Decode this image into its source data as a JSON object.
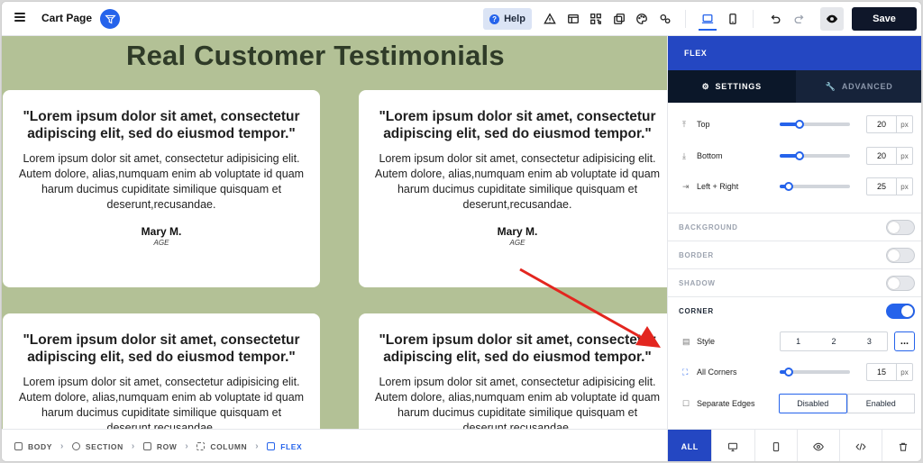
{
  "topbar": {
    "page_name": "Cart Page",
    "help_label": "Help",
    "save_label": "Save"
  },
  "canvas": {
    "title": "Real Customer Testimonials",
    "cards": [
      {
        "quote": "\"Lorem ipsum dolor sit amet, consectetur adipiscing elit, sed do eiusmod tempor.\"",
        "body": "Lorem ipsum dolor sit amet, consectetur adipisicing elit. Autem dolore, alias,numquam enim ab voluptate id quam harum ducimus cupiditate similique quisquam et deserunt,recusandae.",
        "name": "Mary M.",
        "age": "AGE"
      },
      {
        "quote": "\"Lorem ipsum dolor sit amet, consectetur adipiscing elit, sed do eiusmod tempor.\"",
        "body": "Lorem ipsum dolor sit amet, consectetur adipisicing elit. Autem dolore, alias,numquam enim ab voluptate id quam harum ducimus cupiditate similique quisquam et deserunt,recusandae.",
        "name": "Mary M.",
        "age": "AGE"
      },
      {
        "quote": "\"Lorem ipsum dolor sit amet, consectetur adipiscing elit, sed do eiusmod tempor.\"",
        "body": "Lorem ipsum dolor sit amet, consectetur adipisicing elit. Autem dolore, alias,numquam enim ab voluptate id quam harum ducimus cupiditate similique quisquam et deserunt,recusandae."
      },
      {
        "quote": "\"Lorem ipsum dolor sit amet, consectetur adipiscing elit, sed do eiusmod tempor.\"",
        "body": "Lorem ipsum dolor sit amet, consectetur adipisicing elit. Autem dolore, alias,numquam enim ab voluptate id quam harum ducimus cupiditate similique quisquam et deserunt,recusandae."
      }
    ]
  },
  "breadcrumb": {
    "items": [
      "BODY",
      "SECTION",
      "ROW",
      "COLUMN",
      "FLEX"
    ]
  },
  "panel": {
    "header": "FLEX",
    "tab_settings": "SETTINGS",
    "tab_advanced": "ADVANCED",
    "top_label": "Top",
    "top_value": "20",
    "top_level": 0.25,
    "bottom_label": "Bottom",
    "bottom_value": "20",
    "bottom_level": 0.25,
    "lr_label": "Left + Right",
    "lr_value": "25",
    "lr_level": 0.08,
    "unit": "px",
    "background_label": "BACKGROUND",
    "border_label": "BORDER",
    "shadow_label": "SHADOW",
    "corner_label": "CORNER",
    "style_label": "Style",
    "style_options": [
      "1",
      "2",
      "3"
    ],
    "more_label": "...",
    "all_corners_label": "All Corners",
    "all_corners_value": "15",
    "all_corners_level": 0.08,
    "separate_edges_label": "Separate Edges",
    "disabled_label": "Disabled",
    "enabled_label": "Enabled",
    "all_label": "ALL"
  },
  "colors": {
    "accent": "#2563eb",
    "panel_header": "#2447c2",
    "canvas_bg": "#b3c196",
    "title_color": "#2f3b28",
    "annotation_arrow": "#e3261f"
  }
}
